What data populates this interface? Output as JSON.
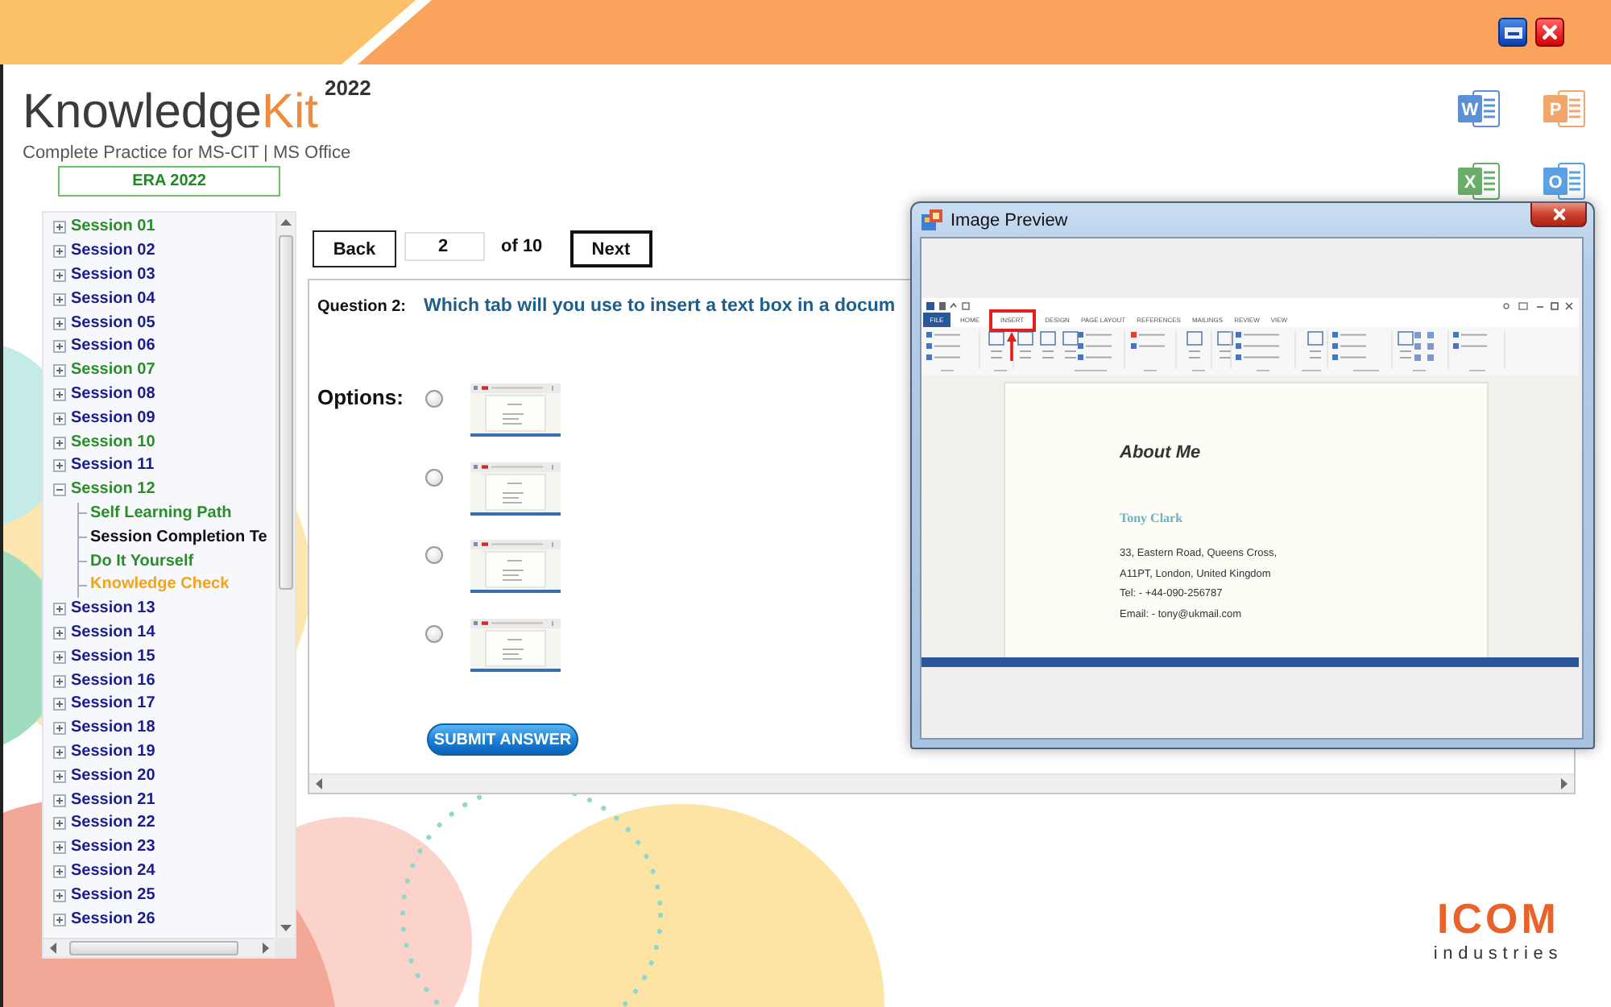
{
  "brand": {
    "name": "Knowledge",
    "name_accent": "Kit",
    "edition": "2022",
    "tagline": "Complete Practice for MS-CIT | MS Office",
    "badge": "ERA 2022"
  },
  "header_buttons": [
    {
      "kind": "minimize"
    },
    {
      "kind": "close"
    }
  ],
  "app_icons": [
    {
      "letter": "W",
      "color": "#5b8fd6"
    },
    {
      "letter": "P",
      "color": "#f2a66c"
    },
    {
      "letter": "X",
      "color": "#6aae6a"
    },
    {
      "letter": "O",
      "color": "#5aa2e4"
    }
  ],
  "sidebar": {
    "items": [
      {
        "label": "Session 01",
        "color": "#2a8c2a",
        "expanded": false
      },
      {
        "label": "Session 02",
        "color": "#1c1c8c",
        "expanded": false
      },
      {
        "label": "Session 03",
        "color": "#1c1c8c",
        "expanded": false
      },
      {
        "label": "Session 04",
        "color": "#1c1c8c",
        "expanded": false
      },
      {
        "label": "Session 05",
        "color": "#1c1c8c",
        "expanded": false
      },
      {
        "label": "Session 06",
        "color": "#1c1c8c",
        "expanded": false
      },
      {
        "label": "Session 07",
        "color": "#2a8c2a",
        "expanded": false
      },
      {
        "label": "Session 08",
        "color": "#1c1c8c",
        "expanded": false
      },
      {
        "label": "Session 09",
        "color": "#1c1c8c",
        "expanded": false
      },
      {
        "label": "Session 10",
        "color": "#2a8c2a",
        "expanded": false
      },
      {
        "label": "Session 11",
        "color": "#1c1c8c",
        "expanded": false
      },
      {
        "label": "Session 12",
        "color": "#2a8c2a",
        "expanded": true,
        "children": [
          {
            "label": "Self Learning Path",
            "color": "#2a8c2a"
          },
          {
            "label": "Session Completion Te",
            "color": "#111111"
          },
          {
            "label": "Do It Yourself",
            "color": "#2a8c2a"
          },
          {
            "label": "Knowledge Check",
            "color": "#f5a21b"
          }
        ]
      },
      {
        "label": "Session 13",
        "color": "#1c1c8c",
        "expanded": false
      },
      {
        "label": "Session 14",
        "color": "#1c1c8c",
        "expanded": false
      },
      {
        "label": "Session 15",
        "color": "#1c1c8c",
        "expanded": false
      },
      {
        "label": "Session 16",
        "color": "#1c1c8c",
        "expanded": false
      },
      {
        "label": "Session 17",
        "color": "#1c1c8c",
        "expanded": false
      },
      {
        "label": "Session 18",
        "color": "#1c1c8c",
        "expanded": false
      },
      {
        "label": "Session 19",
        "color": "#1c1c8c",
        "expanded": false
      },
      {
        "label": "Session 20",
        "color": "#1c1c8c",
        "expanded": false
      },
      {
        "label": "Session 21",
        "color": "#1c1c8c",
        "expanded": false
      },
      {
        "label": "Session 22",
        "color": "#1c1c8c",
        "expanded": false
      },
      {
        "label": "Session 23",
        "color": "#1c1c8c",
        "expanded": false
      },
      {
        "label": "Session 24",
        "color": "#1c1c8c",
        "expanded": false
      },
      {
        "label": "Session 25",
        "color": "#1c1c8c",
        "expanded": false
      },
      {
        "label": "Session 26",
        "color": "#1c1c8c",
        "expanded": false
      }
    ]
  },
  "navigation": {
    "back": "Back",
    "page": "2",
    "total": "of 10",
    "next": "Next"
  },
  "question": {
    "label": "Question 2:",
    "text": "Which tab will you use to insert a text box in a docum",
    "options_label": "Options:",
    "options": [
      {
        "selected": false
      },
      {
        "selected": false
      },
      {
        "selected": false
      },
      {
        "selected": false
      }
    ],
    "submit": "SUBMIT ANSWER"
  },
  "image_preview": {
    "title": "Image Preview",
    "document_window": {
      "tabs": [
        {
          "label": "FILE",
          "kind": "file",
          "highlighted": false
        },
        {
          "label": "HOME",
          "kind": "tab",
          "highlighted": false
        },
        {
          "label": "INSERT",
          "kind": "tab",
          "highlighted": true
        },
        {
          "label": "DESIGN",
          "kind": "tab",
          "highlighted": false
        },
        {
          "label": "PAGE LAYOUT",
          "kind": "tab",
          "highlighted": false
        },
        {
          "label": "REFERENCES",
          "kind": "tab",
          "highlighted": false
        },
        {
          "label": "MAILINGS",
          "kind": "tab",
          "highlighted": false
        },
        {
          "label": "REVIEW",
          "kind": "tab",
          "highlighted": false
        },
        {
          "label": "VIEW",
          "kind": "tab",
          "highlighted": false
        }
      ],
      "heading": "About Me",
      "name": "Tony Clark",
      "lines": [
        "33, Eastern Road, Queens Cross,",
        "A11PT, London, United Kingdom",
        "Tel: - +44-090-256787",
        "Email: - tony@ukmail.com"
      ]
    }
  },
  "company_logo": {
    "name": "ICOM",
    "tagline": "industries"
  }
}
